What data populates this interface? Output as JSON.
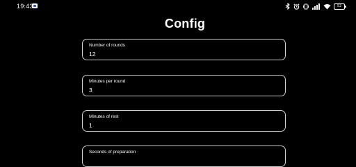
{
  "status_bar": {
    "time": "19:43",
    "battery_level": "52",
    "icons": [
      "bluetooth-icon",
      "alarm-icon",
      "vibrate-icon",
      "signal-icon",
      "wifi-icon",
      "battery-icon"
    ]
  },
  "title": "Config",
  "fields": [
    {
      "label": "Number of rounds",
      "value": "12"
    },
    {
      "label": "Minutes per round",
      "value": "3"
    },
    {
      "label": "Minutes of rest",
      "value": "1"
    },
    {
      "label": "Seconds of preparation",
      "value": ""
    }
  ],
  "colors": {
    "background": "#000000",
    "text": "#ffffff",
    "field_border": "#cfcfcf"
  }
}
